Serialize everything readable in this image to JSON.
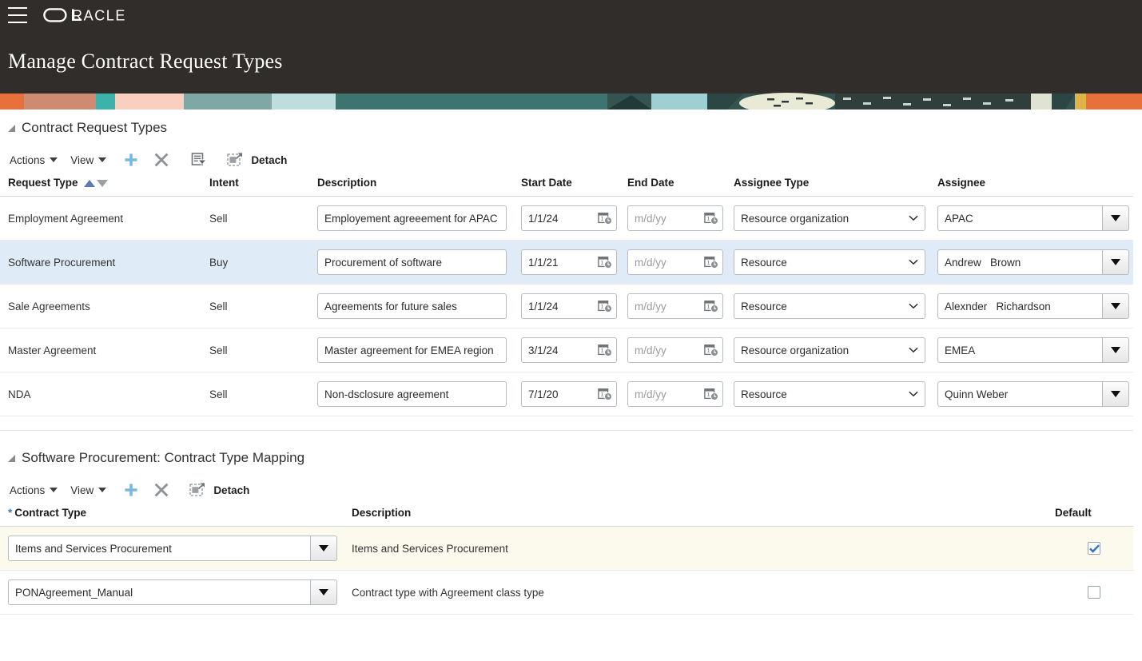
{
  "header": {
    "menu_icon": "hamburger-menu-icon",
    "brand": "ORACLE",
    "title": "Manage Contract Request Types"
  },
  "section1": {
    "title": "Contract Request Types",
    "toolbar": {
      "actions_label": "Actions",
      "view_label": "View",
      "add_icon": "plus-icon",
      "delete_icon": "cross-icon",
      "query_icon": "query-by-example-icon",
      "detach_icon": "detach-icon",
      "detach_label": "Detach"
    },
    "columns": {
      "request_type": "Request Type",
      "intent": "Intent",
      "description": "Description",
      "start_date": "Start Date",
      "end_date": "End Date",
      "assignee_type": "Assignee Type",
      "assignee": "Assignee"
    },
    "date_placeholder": "m/d/yy",
    "rows": [
      {
        "request_type": "Employment Agreement",
        "intent": "Sell",
        "description": "Employement agreeement for APAC",
        "start_date": "1/1/24",
        "end_date": "",
        "assignee_type": "Resource organization",
        "assignee": "APAC",
        "selected": false
      },
      {
        "request_type": "Software Procurement",
        "intent": "Buy",
        "description": "Procurement of software",
        "start_date": "1/1/21",
        "end_date": "",
        "assignee_type": "Resource",
        "assignee": "Andrew   Brown",
        "selected": true
      },
      {
        "request_type": "Sale Agreements",
        "intent": "Sell",
        "description": "Agreements for future sales",
        "start_date": "1/1/24",
        "end_date": "",
        "assignee_type": "Resource",
        "assignee": "Alexnder   Richardson",
        "selected": false
      },
      {
        "request_type": "Master Agreement",
        "intent": "Sell",
        "description": "Master agreement for EMEA region",
        "start_date": "3/1/24",
        "end_date": "",
        "assignee_type": "Resource organization",
        "assignee": "EMEA",
        "selected": false
      },
      {
        "request_type": "NDA",
        "intent": "Sell",
        "description": "Non-dsclosure agreement",
        "start_date": "7/1/20",
        "end_date": "",
        "assignee_type": "Resource",
        "assignee": "Quinn Weber",
        "selected": false
      }
    ]
  },
  "section2": {
    "title": "Software Procurement: Contract Type Mapping",
    "toolbar": {
      "actions_label": "Actions",
      "view_label": "View",
      "add_icon": "plus-icon",
      "delete_icon": "cross-icon",
      "detach_icon": "detach-icon",
      "detach_label": "Detach"
    },
    "columns": {
      "required_marker": "*",
      "contract_type": "Contract Type",
      "description": "Description",
      "default": "Default"
    },
    "rows": [
      {
        "contract_type": "Items and Services Procurement",
        "description": "Items and Services Procurement",
        "is_default": true,
        "highlight": true
      },
      {
        "contract_type": "PONAgreement_Manual",
        "description": "Contract type with Agreement class type",
        "is_default": false,
        "highlight": false
      }
    ]
  },
  "colors": {
    "header_bg": "#312d2a",
    "selected_row": "#dfebf7",
    "highlight_row": "#fbfaec",
    "accent_blue": "#3b7ac4",
    "plus_blue": "#7ab8dd"
  }
}
